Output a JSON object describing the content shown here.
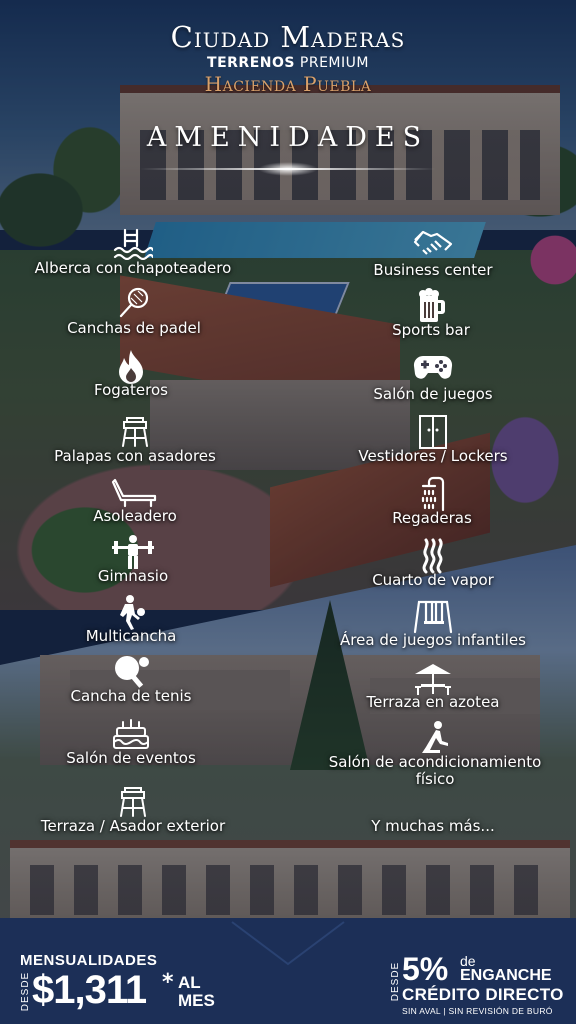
{
  "header": {
    "brand_title": "Ciudad Maderas",
    "subtitle_bold": "TERRENOS",
    "subtitle_rest": " PREMIUM",
    "project": "Hacienda Puebla",
    "section_title": "AMENIDADES"
  },
  "amenities_left": [
    {
      "label": "Alberca con chapoteadero",
      "icon": "pool-icon"
    },
    {
      "label": "Canchas de padel",
      "icon": "padel-racket-icon"
    },
    {
      "label": "Fogateros",
      "icon": "fire-icon"
    },
    {
      "label": "Palapas con asadores",
      "icon": "grill-icon"
    },
    {
      "label": "Asoleadero",
      "icon": "sunlounger-icon"
    },
    {
      "label": "Gimnasio",
      "icon": "weightlifting-icon"
    },
    {
      "label": "Multicancha",
      "icon": "basketball-player-icon"
    },
    {
      "label": "Cancha de tenis",
      "icon": "tennis-icon"
    },
    {
      "label": "Salón de eventos",
      "icon": "cake-icon"
    },
    {
      "label": "Terraza / Asador exterior",
      "icon": "grill-icon"
    }
  ],
  "amenities_right": [
    {
      "label": "Business center",
      "icon": "handshake-icon"
    },
    {
      "label": "Sports bar",
      "icon": "beer-mug-icon"
    },
    {
      "label": "Salón de juegos",
      "icon": "gamepad-icon"
    },
    {
      "label": "Vestidores / Lockers",
      "icon": "lockers-icon"
    },
    {
      "label": "Regaderas",
      "icon": "shower-icon"
    },
    {
      "label": "Cuarto de vapor",
      "icon": "steam-icon"
    },
    {
      "label": "Área de juegos infantiles",
      "icon": "swing-icon"
    },
    {
      "label": "Terraza en azotea",
      "icon": "umbrella-table-icon"
    },
    {
      "label": "Salón de acondicionamiento",
      "label2": "físico",
      "icon": "yoga-icon"
    },
    {
      "label": "Y muchas más...",
      "icon": ""
    }
  ],
  "footer": {
    "mensualidades": "MENSUALIDADES",
    "desde": "DESDE",
    "price": "$1,311",
    "star": "*",
    "al": "AL",
    "mes": "MES",
    "desde_right": "DESDE",
    "percent": "5%",
    "de": "de",
    "enganche": "ENGANCHE",
    "credito": "CRÉDITO DIRECTO",
    "sin_aval": "SIN AVAL | SIN REVISIÓN DE BURÓ"
  },
  "colors": {
    "accent_copper": "#d9a06a",
    "footer_navy": "#1c2f57"
  }
}
